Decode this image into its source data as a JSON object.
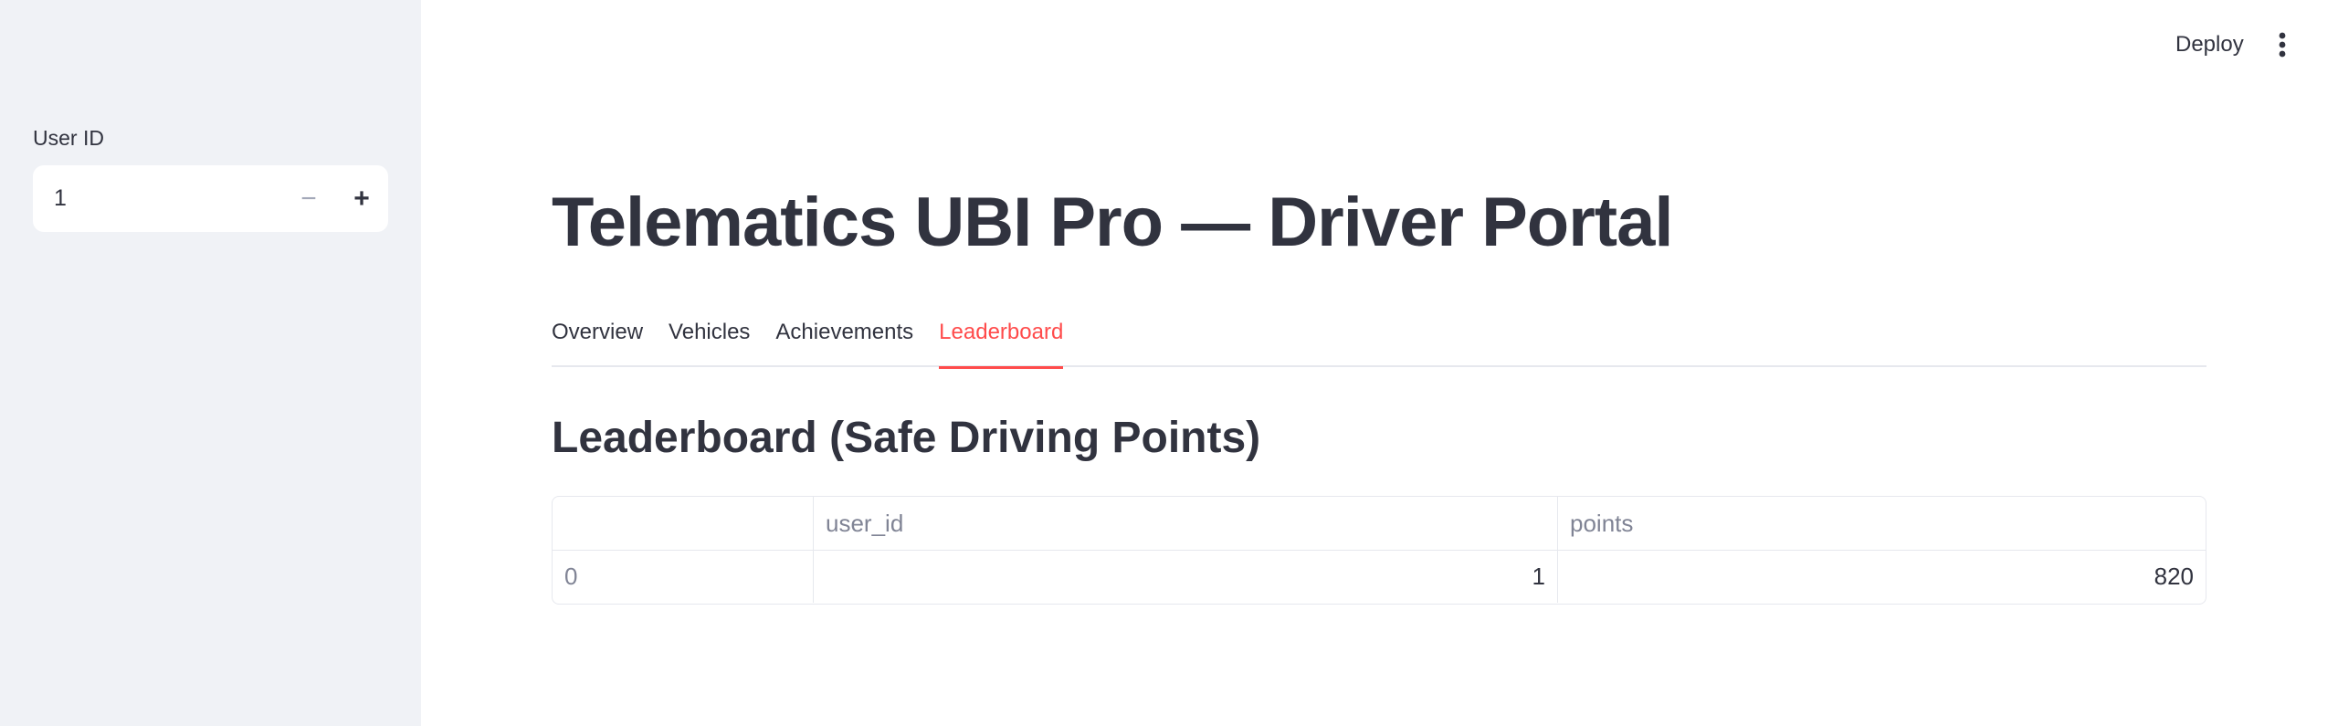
{
  "sidebar": {
    "user_id_label": "User ID",
    "user_id_value": "1",
    "minus_label": "−",
    "plus_label": "+"
  },
  "toolbar": {
    "deploy_label": "Deploy",
    "menu_icon": "vertical-dots-icon"
  },
  "main": {
    "title": "Telematics UBI Pro — Driver Portal",
    "tabs": [
      {
        "label": "Overview",
        "active": false
      },
      {
        "label": "Vehicles",
        "active": false
      },
      {
        "label": "Achievements",
        "active": false
      },
      {
        "label": "Leaderboard",
        "active": true
      }
    ],
    "section_heading": "Leaderboard (Safe Driving Points)",
    "table": {
      "columns": [
        "",
        "user_id",
        "points"
      ],
      "rows": [
        {
          "index": "0",
          "user_id": "1",
          "points": "820"
        }
      ]
    }
  },
  "colors": {
    "accent": "#ff4b4b",
    "sidebar_bg": "#f0f2f6",
    "text": "#31333f"
  }
}
